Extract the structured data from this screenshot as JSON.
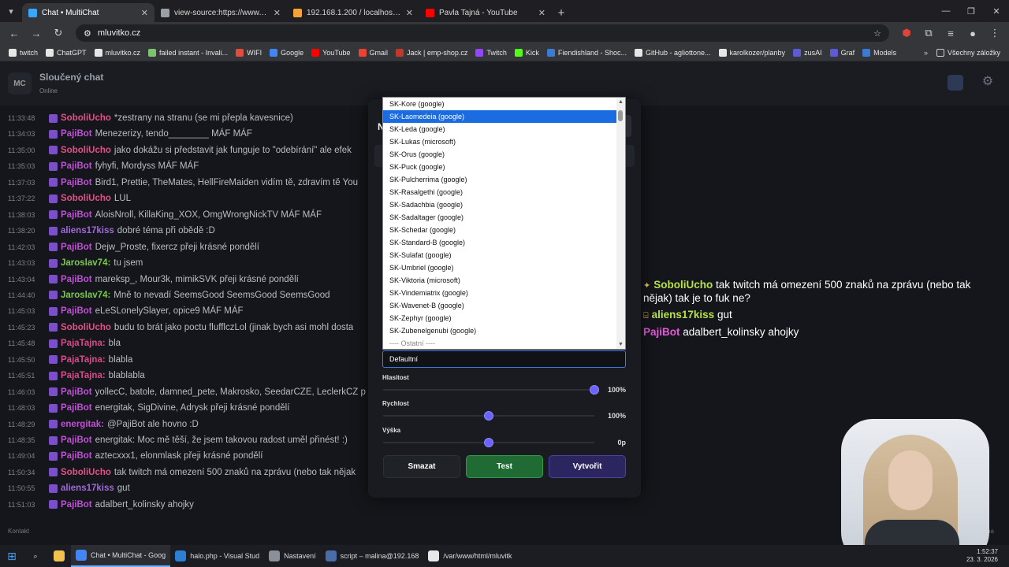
{
  "browser": {
    "tabs": [
      {
        "title": "Chat • MultiChat",
        "color": "#3aa7ff",
        "active": true
      },
      {
        "title": "view-source:https://www.mluvit",
        "color": "#9aa0a6",
        "active": false
      },
      {
        "title": "192.168.1.200 / localhost / mlu",
        "color": "#f2a33a",
        "active": false
      },
      {
        "title": "Pavla Tajná - YouTube",
        "color": "#ff0000",
        "active": false
      }
    ],
    "url": "mluvitko.cz",
    "bookmarks": [
      {
        "label": "twitch",
        "color": "#e6e6e6"
      },
      {
        "label": "ChatGPT",
        "color": "#e6e6e6"
      },
      {
        "label": "mluvitko.cz",
        "color": "#e6e6e6"
      },
      {
        "label": "failed instant - Invali...",
        "color": "#7cc36e"
      },
      {
        "label": "WIFI",
        "color": "#e24c3d"
      },
      {
        "label": "Google",
        "color": "#4285f4"
      },
      {
        "label": "YouTube",
        "color": "#ff0000"
      },
      {
        "label": "Gmail",
        "color": "#ea4335"
      },
      {
        "label": "Jack | emp-shop.cz",
        "color": "#c0392b"
      },
      {
        "label": "Twitch",
        "color": "#9146ff"
      },
      {
        "label": "Kick",
        "color": "#53fc18"
      },
      {
        "label": "Fiendishland - Shoc...",
        "color": "#3a7bd5"
      },
      {
        "label": "GitHub - agliottone...",
        "color": "#e6e6e6"
      },
      {
        "label": "karolkozer/planby",
        "color": "#e6e6e6"
      },
      {
        "label": "zusAI",
        "color": "#5b5bd6"
      },
      {
        "label": "Graf",
        "color": "#5b5bd6"
      },
      {
        "label": "Models",
        "color": "#3a7bd5"
      }
    ],
    "bookmarks_all": "Všechny záložky"
  },
  "app": {
    "logo": "MC",
    "title": "Sloučený chat",
    "status": "Online",
    "footer": "Kontakt",
    "footer_right": "ýna"
  },
  "chat": [
    {
      "time": "11:33:48",
      "user": "SoboliUcho",
      "color": "#e2508a",
      "msg": "*zestrany na stranu (se mi přepla kavesnice)"
    },
    {
      "time": "11:34:03",
      "user": "PajiBot",
      "color": "#c14fd6",
      "msg": "Menezerizy, tendo________ MÁF MÁF"
    },
    {
      "time": "11:35:00",
      "user": "SoboliUcho",
      "color": "#e2508a",
      "msg": "jako dokážu si představit jak funguje to \"odebírání\" ale efek"
    },
    {
      "time": "11:35:03",
      "user": "PajiBot",
      "color": "#c14fd6",
      "msg": "fyhyfi, Mordyss MÁF MÁF"
    },
    {
      "time": "11:37:03",
      "user": "PajiBot",
      "color": "#c14fd6",
      "msg": "Bird1, Prettie, TheMates, HellFireMaiden vidím tě, zdravím tě You"
    },
    {
      "time": "11:37:22",
      "user": "SoboliUcho",
      "color": "#e2508a",
      "msg": "LUL"
    },
    {
      "time": "11:38:03",
      "user": "PajiBot",
      "color": "#c14fd6",
      "msg": "AloisNroll, KillaKing_XOX, OmgWrongNickTV MÁF MÁF"
    },
    {
      "time": "11:38:20",
      "user": "aliens17kiss",
      "color": "#a06ad6",
      "msg": "dobré téma při obědě :D"
    },
    {
      "time": "11:42:03",
      "user": "PajiBot",
      "color": "#c14fd6",
      "msg": "Dejw_Proste, fixercz přeji krásné pondělí"
    },
    {
      "time": "11:43:03",
      "user": "Jaroslav74:",
      "color": "#7bc950",
      "msg": "tu jsem"
    },
    {
      "time": "11:43:04",
      "user": "PajiBot",
      "color": "#c14fd6",
      "msg": "mareksp_, Mour3k, mimikSVK přeji krásné pondělí"
    },
    {
      "time": "11:44:40",
      "user": "Jaroslav74:",
      "color": "#7bc950",
      "msg": "Mně to nevadí SeemsGood SeemsGood SeemsGood"
    },
    {
      "time": "11:45:03",
      "user": "PajiBot",
      "color": "#c14fd6",
      "msg": "eLeSLonelySlayer, opice9 MÁF MÁF"
    },
    {
      "time": "11:45:23",
      "user": "SoboliUcho",
      "color": "#e2508a",
      "msg": "budu to brát jako poctu flufflczLol (jinak bych asi mohl dosta"
    },
    {
      "time": "11:45:48",
      "user": "PajaTajna:",
      "color": "#d94a8a",
      "msg": "bla"
    },
    {
      "time": "11:45:50",
      "user": "PajaTajna:",
      "color": "#d94a8a",
      "msg": "blabla"
    },
    {
      "time": "11:45:51",
      "user": "PajaTajna:",
      "color": "#d94a8a",
      "msg": "blablabla"
    },
    {
      "time": "11:46:03",
      "user": "PajiBot",
      "color": "#c14fd6",
      "msg": "yollecC, batole, damned_pete, Makrosko, SeedarCZE, LeclerkCZ p"
    },
    {
      "time": "11:48:03",
      "user": "PajiBot",
      "color": "#c14fd6",
      "msg": "energitak, SigDivine, Adrysk přeji krásné pondělí"
    },
    {
      "time": "11:48:29",
      "user": "energitak:",
      "color": "#c14fd6",
      "msg": "@PajiBot ale hovno :D"
    },
    {
      "time": "11:48:35",
      "user": "PajiBot",
      "color": "#c14fd6",
      "msg": "energitak: Moc mě těší, že jsem takovou radost uměl přinést! :)"
    },
    {
      "time": "11:49:04",
      "user": "PajiBot",
      "color": "#c14fd6",
      "msg": "aztecxxx1, elonmlask přeji krásné pondělí"
    },
    {
      "time": "11:50:34",
      "user": "SoboliUcho",
      "color": "#e2508a",
      "msg": "tak twitch má omezení 500 znaků na zprávu (nebo tak nějak"
    },
    {
      "time": "11:50:55",
      "user": "aliens17kiss",
      "color": "#a06ad6",
      "msg": "gut"
    },
    {
      "time": "11:51:03",
      "user": "PajiBot",
      "color": "#c14fd6",
      "msg": "adalbert_kolinsky ahojky"
    }
  ],
  "overlay": [
    {
      "user": "SoboliUcho",
      "color": "#b7e14a",
      "msg": "tak twitch má omezení 500 znaků na zprávu (nebo tak nějak) tak je to fuk ne?",
      "icon": "✦"
    },
    {
      "user": "aliens17kiss",
      "color": "#b7e14a",
      "msg": "gut",
      "icon": "⌸"
    },
    {
      "user": "PajiBot",
      "color": "#e35ad8",
      "msg": "adalbert_kolinsky ahojky",
      "icon": ""
    }
  ],
  "modal": {
    "title": "N",
    "voice_options": [
      "SK-Kore (google)",
      "SK-Laomedeia (google)",
      "SK-Leda (google)",
      "SK-Lukas (microsoft)",
      "SK-Orus (google)",
      "SK-Puck (google)",
      "SK-Pulcherrima (google)",
      "SK-Rasalgethi (google)",
      "SK-Sadachbia (google)",
      "SK-Sadaltager (google)",
      "SK-Schedar (google)",
      "SK-Standard-B (google)",
      "SK-Sulafat (google)",
      "SK-Umbriel (google)",
      "SK-Viktoria (microsoft)",
      "SK-Vindemiatrix (google)",
      "SK-Wavenet-B (google)",
      "SK-Zephyr (google)",
      "SK-Zubenelgenubi (google)"
    ],
    "selected_index": 1,
    "group_label": "---- Ostatní ----",
    "select_value": "Defaultní",
    "volume": {
      "label": "Hlasitost",
      "value": "100%",
      "level": 1.0
    },
    "speed": {
      "label": "Rychlost",
      "value": "100%",
      "level": 0.5
    },
    "pitch": {
      "label": "Výška",
      "value": "0p",
      "level": 0.5
    },
    "btn_delete": "Smazat",
    "btn_test": "Test",
    "btn_create": "Vytvořit"
  },
  "taskbar": {
    "items": [
      {
        "label": "Chat • MultiChat - Goog",
        "color": "#4285f4",
        "active": true
      },
      {
        "label": "halo.php - Visual Stud",
        "color": "#2d7fd3",
        "active": false
      },
      {
        "label": "Nastavení",
        "color": "#8a8f98",
        "active": false
      },
      {
        "label": "script – malina@192.168",
        "color": "#4a6da7",
        "active": false
      },
      {
        "label": "/var/www/html/mluvitk",
        "color": "#e8e8e8",
        "active": false
      }
    ],
    "time": "1:52:37",
    "date": "23. 3. 2026"
  }
}
